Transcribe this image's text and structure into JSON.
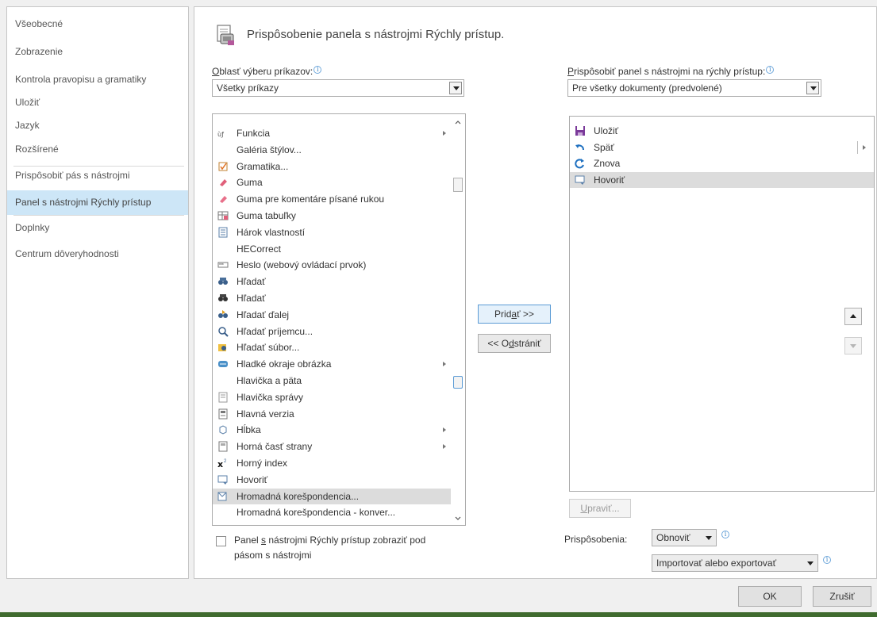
{
  "sidebar": {
    "items": [
      {
        "label": "Všeobecné"
      },
      {
        "label": "Zobrazenie"
      },
      {
        "label": "Kontrola pravopisu a gramatiky"
      },
      {
        "label": "Uložiť"
      },
      {
        "label": "Jazyk"
      },
      {
        "label": "Rozšírené"
      },
      {
        "label": "Prispôsobiť pás s nástrojmi"
      },
      {
        "label": "Panel s nástrojmi Rýchly prístup"
      },
      {
        "label": "Doplnky"
      },
      {
        "label": "Centrum dôveryhodnosti"
      }
    ],
    "active_index": 7
  },
  "main": {
    "title": "Prispôsobenie panela s nástrojmi Rýchly prístup.",
    "commands_label_first": "O",
    "commands_label_rest": "blasť výberu príkazov:",
    "commands_select": "Všetky príkazy",
    "qat_label_first": "P",
    "qat_label_rest": "rispôsobiť panel s nástrojmi na rýchly prístup:",
    "qat_select": "Pre všetky dokumenty (predvolené)",
    "commands": [
      {
        "label": "Funkcia",
        "icon": "function-icon",
        "submenu": true
      },
      {
        "label": "Galéria štýlov...",
        "icon": "",
        "submenu": false
      },
      {
        "label": "Gramatika...",
        "icon": "grammar-icon",
        "submenu": false
      },
      {
        "label": "Guma",
        "icon": "eraser-icon",
        "submenu": false
      },
      {
        "label": "Guma pre komentáre písané rukou",
        "icon": "ink-eraser-icon",
        "submenu": false
      },
      {
        "label": "Guma tabuľky",
        "icon": "table-eraser-icon",
        "submenu": false
      },
      {
        "label": "Hárok vlastností",
        "icon": "property-sheet-icon",
        "submenu": false
      },
      {
        "label": "HECorrect",
        "icon": "",
        "submenu": false
      },
      {
        "label": "Heslo (webový ovládací prvok)",
        "icon": "password-control-icon",
        "submenu": false
      },
      {
        "label": "Hľadať",
        "icon": "find-icon",
        "submenu": false
      },
      {
        "label": "Hľadať",
        "icon": "binoculars-icon",
        "submenu": false
      },
      {
        "label": "Hľadať ďalej",
        "icon": "find-next-icon",
        "submenu": false
      },
      {
        "label": "Hľadať príjemcu...",
        "icon": "find-recipient-icon",
        "submenu": false
      },
      {
        "label": "Hľadať súbor...",
        "icon": "find-file-icon",
        "submenu": false
      },
      {
        "label": "Hladké okraje obrázka",
        "icon": "soft-edges-icon",
        "submenu": true
      },
      {
        "label": "Hlavička a päta",
        "icon": "",
        "submenu": false
      },
      {
        "label": "Hlavička správy",
        "icon": "message-header-icon",
        "submenu": false
      },
      {
        "label": "Hlavná verzia",
        "icon": "major-version-icon",
        "submenu": false
      },
      {
        "label": "Hĺbka",
        "icon": "depth-icon",
        "submenu": true
      },
      {
        "label": "Horná časť strany",
        "icon": "top-of-page-icon",
        "submenu": true
      },
      {
        "label": "Horný index",
        "icon": "superscript-icon",
        "submenu": false
      },
      {
        "label": "Hovoriť",
        "icon": "speak-icon",
        "submenu": false
      },
      {
        "label": "Hromadná korešpondencia...",
        "icon": "mail-merge-icon",
        "submenu": false
      },
      {
        "label": "Hromadná korešpondencia - konver...",
        "icon": "",
        "submenu": false
      }
    ],
    "selected_command_index": 22,
    "add_button_pre": "Prid",
    "add_button_u": "a",
    "add_button_post": "ť >>",
    "remove_button_pre": "<< O",
    "remove_button_u": "d",
    "remove_button_post": "strániť",
    "qat_items": [
      {
        "label": "Uložiť",
        "icon": "save-icon",
        "separator": false
      },
      {
        "label": "Späť",
        "icon": "undo-icon",
        "separator": true
      },
      {
        "label": "Znova",
        "icon": "redo-icon",
        "separator": false
      },
      {
        "label": "Hovoriť",
        "icon": "speak-icon",
        "separator": false
      }
    ],
    "selected_qat_index": 3,
    "modify_button_u": "U",
    "modify_button_rest": "praviť...",
    "customizations_label": "Prispôsobenia:",
    "reset_button_pre": "Obno",
    "reset_button_u": "v",
    "reset_button_post": "iť",
    "import_export_button_u": "I",
    "import_export_button_rest": "mportovať alebo exportovať",
    "checkbox_label_line1_pre": "Panel ",
    "checkbox_label_line1_u": "s",
    "checkbox_label_line1_post": " nástrojmi Rýchly prístup zobraziť pod",
    "checkbox_label_line2": "pásom s nástrojmi"
  },
  "footer": {
    "ok_label": "OK",
    "cancel_label": "Zrušiť"
  },
  "colors": {
    "active_sidebar": "#cde6f7",
    "selected_row": "#dcdcdc",
    "accent": "#5b9bd5"
  }
}
